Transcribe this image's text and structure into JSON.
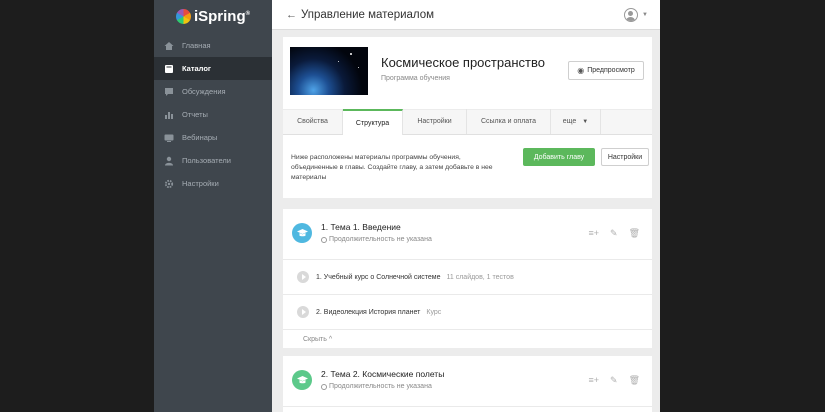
{
  "logo": {
    "text": "iSpring"
  },
  "sidebar": {
    "items": [
      {
        "label": "Главная",
        "icon": "home-icon"
      },
      {
        "label": "Каталог",
        "icon": "book-icon",
        "active": true
      },
      {
        "label": "Обсуждения",
        "icon": "chat-icon"
      },
      {
        "label": "Отчеты",
        "icon": "chart-icon"
      },
      {
        "label": "Вебинары",
        "icon": "webinar-icon"
      },
      {
        "label": "Пользователи",
        "icon": "user-icon"
      },
      {
        "label": "Настройки",
        "icon": "gear-icon"
      }
    ]
  },
  "header": {
    "title": "Управление материалом"
  },
  "course": {
    "title": "Космическое пространство",
    "subtitle": "Программа обучения",
    "preview_label": "Предпросмотр"
  },
  "tabs": [
    {
      "label": "Свойства"
    },
    {
      "label": "Структура",
      "active": true
    },
    {
      "label": "Настройки"
    },
    {
      "label": "Ссылка и оплата"
    },
    {
      "label": "еще"
    }
  ],
  "structure": {
    "hint": "Ниже расположены материалы программы обучения, объединенные в главы. Создайте главу, а затем добавьте в нее материалы",
    "add_chapter_label": "Добавить главу",
    "settings_label": "Настройки"
  },
  "chapters": [
    {
      "title": "1. Тема 1. Введение",
      "duration": "Продолжительность не указана",
      "color": "#4fb8e0",
      "materials": [
        {
          "title": "1. Учебный курс о Солнечной системе",
          "meta": "11 слайдов, 1 тестов"
        },
        {
          "title": "2. Видеолекция История планет",
          "meta": "Курс"
        }
      ],
      "collapse_label": "Скрыть"
    },
    {
      "title": "2. Тема 2. Космические полеты",
      "duration": "Продолжительность не указана",
      "color": "#5cc98a"
    }
  ],
  "colors": {
    "sidebar": "#3f464d",
    "accent": "#5cb85c"
  }
}
